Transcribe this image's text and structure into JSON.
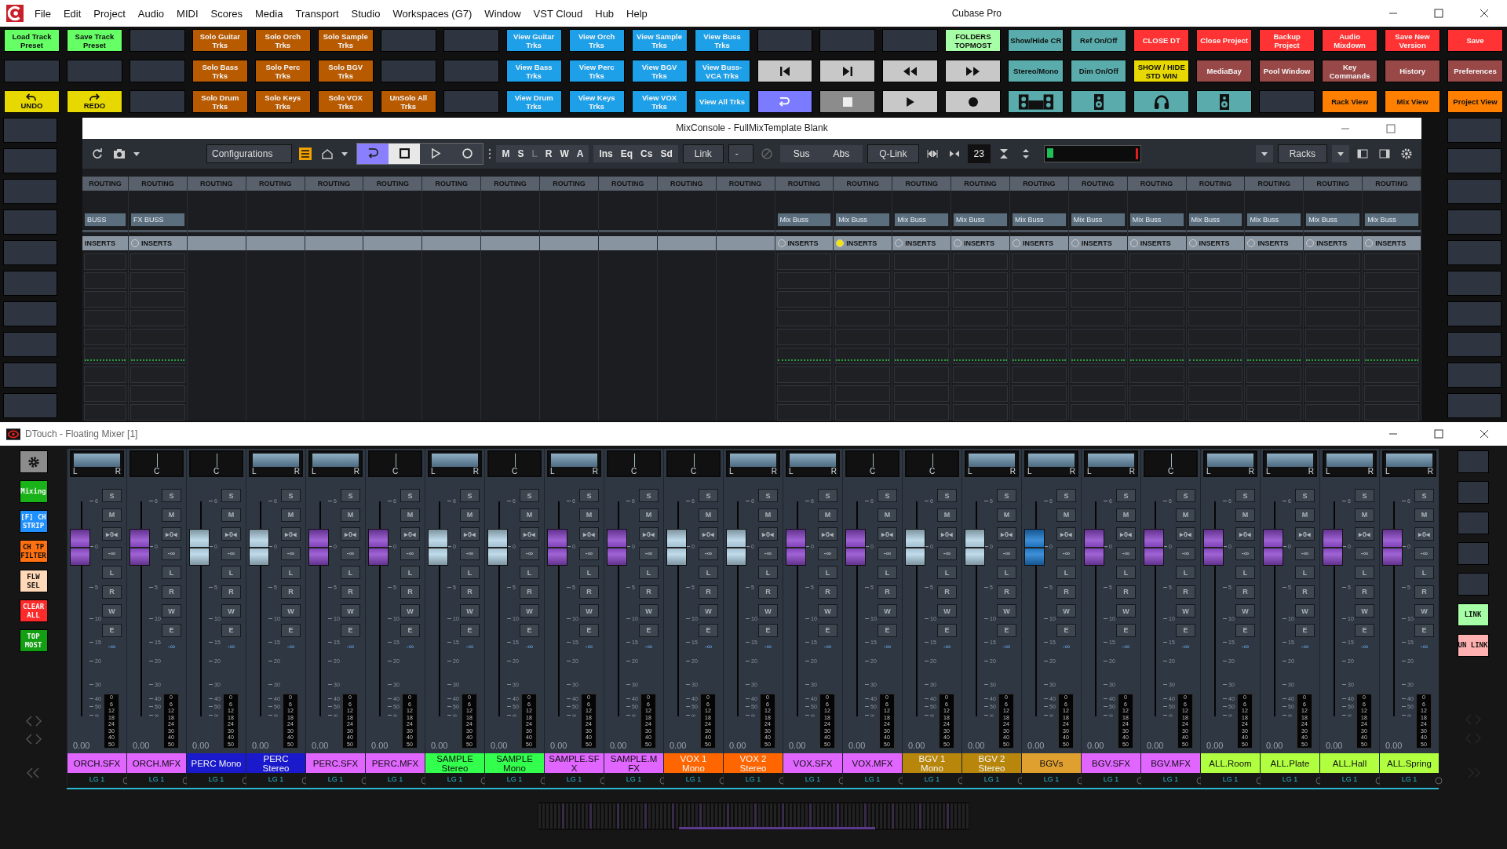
{
  "window": {
    "title": "Cubase Pro"
  },
  "menu": [
    "File",
    "Edit",
    "Project",
    "Audio",
    "MIDI",
    "Scores",
    "Media",
    "Transport",
    "Studio",
    "Workspaces (G7)",
    "Window",
    "VST Cloud",
    "Hub",
    "Help"
  ],
  "pad_rows": [
    [
      {
        "kind": "text",
        "label": "Load Track Preset",
        "color": "#66ff66"
      },
      {
        "kind": "text",
        "label": "Save Track Preset",
        "color": "#66ff66"
      },
      {
        "kind": "blank",
        "color": "#2e3540"
      },
      {
        "kind": "text",
        "label": "Solo Guitar Trks",
        "color": "#b85a00"
      },
      {
        "kind": "text",
        "label": "Solo Orch Trks",
        "color": "#b85a00"
      },
      {
        "kind": "text",
        "label": "Solo Sample Trks",
        "color": "#b85a00"
      },
      {
        "kind": "blank",
        "color": "#2e3540"
      },
      {
        "kind": "blank",
        "color": "#2e3540"
      },
      {
        "kind": "text",
        "label": "View Guitar Trks",
        "color": "#1ea0e8"
      },
      {
        "kind": "text",
        "label": "View Orch Trks",
        "color": "#1ea0e8"
      },
      {
        "kind": "text",
        "label": "View Sample Trks",
        "color": "#1ea0e8"
      },
      {
        "kind": "text",
        "label": "View Buss Trks",
        "color": "#1ea0e8"
      },
      {
        "kind": "blank",
        "color": "#2e3540"
      },
      {
        "kind": "blank",
        "color": "#2e3540"
      },
      {
        "kind": "blank",
        "color": "#2e3540"
      },
      {
        "kind": "text",
        "label": "FOLDERS TOPMOST",
        "color": "#a6ffa6"
      },
      {
        "kind": "text",
        "label": "Show/Hide CR",
        "color": "#5aacac"
      },
      {
        "kind": "text",
        "label": "Ref On/Off",
        "color": "#5aacac"
      },
      {
        "kind": "text",
        "label": "CLOSE DT",
        "color": "#ff3333"
      },
      {
        "kind": "text",
        "label": "Close Project",
        "color": "#ff3333"
      },
      {
        "kind": "text",
        "label": "Backup Project",
        "color": "#ff3333"
      },
      {
        "kind": "text",
        "label": "Audio Mixdown",
        "color": "#ff3333"
      },
      {
        "kind": "text",
        "label": "Save New Version",
        "color": "#ff3333"
      },
      {
        "kind": "text",
        "label": "Save",
        "color": "#ff3333"
      }
    ],
    [
      {
        "kind": "blank",
        "color": "#2e3540"
      },
      {
        "kind": "blank",
        "color": "#2e3540"
      },
      {
        "kind": "blank",
        "color": "#2e3540"
      },
      {
        "kind": "text",
        "label": "Solo Bass Trks",
        "color": "#b85a00"
      },
      {
        "kind": "text",
        "label": "Solo Perc Trks",
        "color": "#b85a00"
      },
      {
        "kind": "text",
        "label": "Solo BGV Trks",
        "color": "#b85a00"
      },
      {
        "kind": "blank",
        "color": "#2e3540"
      },
      {
        "kind": "blank",
        "color": "#2e3540"
      },
      {
        "kind": "text",
        "label": "View Bass Trks",
        "color": "#1ea0e8"
      },
      {
        "kind": "text",
        "label": "View Perc Trks",
        "color": "#1ea0e8"
      },
      {
        "kind": "text",
        "label": "View BGV Trks",
        "color": "#1ea0e8"
      },
      {
        "kind": "text",
        "label": "View Buss-VCA Trks",
        "color": "#1ea0e8"
      },
      {
        "kind": "prev",
        "color": "#c8c8c8"
      },
      {
        "kind": "next",
        "color": "#c8c8c8"
      },
      {
        "kind": "rewind",
        "color": "#c8c8c8"
      },
      {
        "kind": "forward",
        "color": "#c8c8c8"
      },
      {
        "kind": "text",
        "label": "Stereo/Mono",
        "color": "#5aacac"
      },
      {
        "kind": "text",
        "label": "Dim On/Off",
        "color": "#5aacac"
      },
      {
        "kind": "text",
        "label": "SHOW / HIDE STD WIN",
        "color": "#e6d800"
      },
      {
        "kind": "text",
        "label": "MediaBay",
        "color": "#994848"
      },
      {
        "kind": "text",
        "label": "Pool Window",
        "color": "#994848"
      },
      {
        "kind": "text",
        "label": "Key Commands",
        "color": "#994848"
      },
      {
        "kind": "text",
        "label": "History",
        "color": "#994848"
      },
      {
        "kind": "text",
        "label": "Preferences",
        "color": "#994848"
      }
    ],
    [
      {
        "kind": "undo",
        "label": "UNDO",
        "color": "#e6d800"
      },
      {
        "kind": "redo",
        "label": "REDO",
        "color": "#e6d800"
      },
      {
        "kind": "blank",
        "color": "#2e3540"
      },
      {
        "kind": "text",
        "label": "Solo Drum Trks",
        "color": "#b85a00"
      },
      {
        "kind": "text",
        "label": "Solo Keys Trks",
        "color": "#b85a00"
      },
      {
        "kind": "text",
        "label": "Solo VOX Trks",
        "color": "#b85a00"
      },
      {
        "kind": "text",
        "label": "UnSolo All Trks",
        "color": "#b85a00"
      },
      {
        "kind": "blank",
        "color": "#2e3540"
      },
      {
        "kind": "text",
        "label": "View Drum Trks",
        "color": "#1ea0e8"
      },
      {
        "kind": "text",
        "label": "View Keys Trks",
        "color": "#1ea0e8"
      },
      {
        "kind": "text",
        "label": "View VOX Trks",
        "color": "#1ea0e8"
      },
      {
        "kind": "text",
        "label": "View All Trks",
        "color": "#1ea0e8"
      },
      {
        "kind": "cycle",
        "color": "#7b7bff"
      },
      {
        "kind": "stop",
        "color": "#8c8c8c"
      },
      {
        "kind": "play",
        "color": "#c8c8c8"
      },
      {
        "kind": "record",
        "color": "#c8c8c8"
      },
      {
        "kind": "tape",
        "color": "#5aacac"
      },
      {
        "kind": "speaker",
        "color": "#5aacac"
      },
      {
        "kind": "headphones",
        "color": "#5aacac"
      },
      {
        "kind": "speaker",
        "color": "#5aacac"
      },
      {
        "kind": "blank",
        "color": "#2e3540"
      },
      {
        "kind": "text",
        "label": "Rack View",
        "color": "#ff8000"
      },
      {
        "kind": "text",
        "label": "Mix View",
        "color": "#ff8000"
      },
      {
        "kind": "text",
        "label": "Project View",
        "color": "#ff8000"
      }
    ]
  ],
  "side_left": [
    {
      "kind": "blank"
    },
    {
      "kind": "blank"
    },
    {
      "kind": "blank"
    },
    {
      "kind": "blank"
    },
    {
      "kind": "blank"
    },
    {
      "kind": "blank"
    },
    {
      "kind": "blank"
    },
    {
      "kind": "blank"
    },
    {
      "kind": "blank"
    },
    {
      "kind": "blank"
    }
  ],
  "side_right": [
    {
      "kind": "blank"
    },
    {
      "kind": "blank"
    },
    {
      "kind": "blank"
    },
    {
      "kind": "blank"
    },
    {
      "kind": "blank"
    },
    {
      "kind": "blank"
    },
    {
      "kind": "blank"
    },
    {
      "kind": "blank"
    },
    {
      "kind": "blank"
    },
    {
      "kind": "blank"
    }
  ],
  "mixconsole": {
    "title": "MixConsole - FullMixTemplate Blank",
    "toolbar": {
      "configurations": "Configurations",
      "automation": [
        {
          "label": "M",
          "enabled": true
        },
        {
          "label": "S",
          "enabled": true
        },
        {
          "label": "L",
          "enabled": false
        },
        {
          "label": "R",
          "enabled": true
        },
        {
          "label": "W",
          "enabled": true
        },
        {
          "label": "A",
          "enabled": true
        }
      ],
      "sections": [
        "Ins",
        "Eq",
        "Cs",
        "Sd"
      ],
      "link": "Link",
      "link_mode": "-",
      "sus": "Sus",
      "abs": "Abs",
      "qlink": "Q-Link",
      "count": "23",
      "racks": "Racks"
    },
    "columns": [
      {
        "routing": "ROUTING",
        "buss": "BUSS",
        "inserts": "INSERTS",
        "active": true
      },
      {
        "routing": "ROUTING",
        "buss": "FX BUSS",
        "inserts": "INSERTS",
        "led_lit": false,
        "active": true
      },
      {
        "routing": "ROUTING",
        "active": false
      },
      {
        "routing": "ROUTING",
        "active": false
      },
      {
        "routing": "ROUTING",
        "active": false
      },
      {
        "routing": "ROUTING",
        "active": false
      },
      {
        "routing": "ROUTING",
        "active": false
      },
      {
        "routing": "ROUTING",
        "active": false
      },
      {
        "routing": "ROUTING",
        "active": false
      },
      {
        "routing": "ROUTING",
        "active": false
      },
      {
        "routing": "ROUTING",
        "active": false
      },
      {
        "routing": "ROUTING",
        "active": false
      },
      {
        "routing": "ROUTING",
        "buss": "Mix Buss",
        "inserts": "INSERTS",
        "led_lit": false,
        "active": true
      },
      {
        "routing": "ROUTING",
        "buss": "Mix Buss",
        "inserts": "INSERTS",
        "led_lit": true,
        "active": true
      },
      {
        "routing": "ROUTING",
        "buss": "Mix Buss",
        "inserts": "INSERTS",
        "led_lit": false,
        "active": true
      },
      {
        "routing": "ROUTING",
        "buss": "Mix Buss",
        "inserts": "INSERTS",
        "led_lit": false,
        "active": true
      },
      {
        "routing": "ROUTING",
        "buss": "Mix Buss",
        "inserts": "INSERTS",
        "led_lit": false,
        "active": true
      },
      {
        "routing": "ROUTING",
        "buss": "Mix Buss",
        "inserts": "INSERTS",
        "led_lit": false,
        "active": true
      },
      {
        "routing": "ROUTING",
        "buss": "Mix Buss",
        "inserts": "INSERTS",
        "led_lit": false,
        "active": true
      },
      {
        "routing": "ROUTING",
        "buss": "Mix Buss",
        "inserts": "INSERTS",
        "led_lit": false,
        "active": true
      },
      {
        "routing": "ROUTING",
        "buss": "Mix Buss",
        "inserts": "INSERTS",
        "led_lit": false,
        "active": true
      },
      {
        "routing": "ROUTING",
        "buss": "Mix Buss",
        "inserts": "INSERTS",
        "led_lit": false,
        "active": true
      },
      {
        "routing": "ROUTING",
        "buss": "Mix Buss",
        "inserts": "INSERTS",
        "led_lit": false,
        "active": true
      }
    ]
  },
  "mixer": {
    "title": "DTouch - Floating Mixer [1]",
    "left_buttons": [
      {
        "kind": "gear",
        "color": "#8c8c8c"
      },
      {
        "kind": "text",
        "label": "Mixing",
        "color": "#19b319"
      },
      {
        "kind": "text",
        "label": "[F] CH STRIP",
        "color": "#1e90ff"
      },
      {
        "kind": "text",
        "label": "CH TP FILTER",
        "color": "#ff7010"
      },
      {
        "kind": "text",
        "label": "FLW SEL",
        "color": "#ffd8b8"
      },
      {
        "kind": "text",
        "label": "CLEAR ALL",
        "color": "#ff2a2a"
      },
      {
        "kind": "text",
        "label": "TOP MOST",
        "color": "#12a012"
      }
    ],
    "right_buttons": [
      {
        "kind": "blank",
        "color": "#2e3540"
      },
      {
        "kind": "blank",
        "color": "#2e3540"
      },
      {
        "kind": "blank",
        "color": "#2e3540"
      },
      {
        "kind": "blank",
        "color": "#2e3540"
      },
      {
        "kind": "blank",
        "color": "#2e3540"
      },
      {
        "kind": "text",
        "label": "LINK",
        "color": "#a6ffa6"
      },
      {
        "kind": "text",
        "label": "UN LINK",
        "color": "#ffb0b0"
      }
    ],
    "strips": [
      {
        "name": "ORCH.SFX",
        "color": "#e066ff",
        "pan": {
          "kind": "stereo",
          "labels": [
            "L",
            "R"
          ]
        },
        "fader": {
          "color": "#8e48cc"
        },
        "buttons": [
          "S",
          "M",
          "▸0◂",
          "-∞",
          "L",
          "R",
          "W",
          "E"
        ],
        "reading": "-∞",
        "fader_scale": [
          "6",
          "0",
          "5",
          "10",
          "15",
          "20",
          "30",
          "40",
          "50",
          "∞"
        ],
        "meter_scale": [
          "0",
          "6",
          "12",
          "18",
          "24",
          "30",
          "40",
          "50"
        ],
        "value": "0.00",
        "group": "LG 1"
      },
      {
        "name": "ORCH.MFX",
        "color": "#e066ff",
        "pan": {
          "kind": "mono",
          "labels": [
            "C"
          ]
        },
        "fader": {
          "color": "#8e48cc"
        },
        "buttons": [
          "S",
          "M",
          "▸0◂",
          "-∞",
          "L",
          "R",
          "W",
          "E"
        ],
        "reading": "-∞",
        "fader_scale": [
          "6",
          "0",
          "5",
          "10",
          "15",
          "20",
          "30",
          "40",
          "50",
          "∞"
        ],
        "meter_scale": [
          "0",
          "6",
          "12",
          "18",
          "24",
          "30",
          "40",
          "50"
        ],
        "value": "0.00",
        "group": "LG 1"
      },
      {
        "name": "PERC Mono",
        "color": "#1a1acc",
        "pan": {
          "kind": "mono",
          "labels": [
            "C"
          ]
        },
        "fader": {
          "color": "#b4d4e6"
        },
        "buttons": [
          "S",
          "M",
          "▸0◂",
          "-∞",
          "L",
          "R",
          "W",
          "E"
        ],
        "reading": "-∞",
        "fader_scale": [
          "6",
          "0",
          "5",
          "10",
          "15",
          "20",
          "30",
          "40",
          "50",
          "∞"
        ],
        "meter_scale": [
          "0",
          "6",
          "12",
          "18",
          "24",
          "30",
          "40",
          "50"
        ],
        "value": "0.00",
        "group": "LG 1"
      },
      {
        "name": "PERC Stereo",
        "color": "#1a1acc",
        "pan": {
          "kind": "stereo",
          "labels": [
            "L",
            "R"
          ]
        },
        "fader": {
          "color": "#b4d4e6"
        },
        "buttons": [
          "S",
          "M",
          "▸0◂",
          "-∞",
          "L",
          "R",
          "W",
          "E"
        ],
        "reading": "-∞",
        "fader_scale": [
          "6",
          "0",
          "5",
          "10",
          "15",
          "20",
          "30",
          "40",
          "50",
          "∞"
        ],
        "meter_scale": [
          "0",
          "6",
          "12",
          "18",
          "24",
          "30",
          "40",
          "50"
        ],
        "value": "0.00",
        "group": "LG 1"
      },
      {
        "name": "PERC.SFX",
        "color": "#e066ff",
        "pan": {
          "kind": "stereo",
          "labels": [
            "L",
            "R"
          ]
        },
        "fader": {
          "color": "#8e48cc"
        },
        "buttons": [
          "S",
          "M",
          "▸0◂",
          "-∞",
          "L",
          "R",
          "W",
          "E"
        ],
        "reading": "-∞",
        "fader_scale": [
          "6",
          "0",
          "5",
          "10",
          "15",
          "20",
          "30",
          "40",
          "50",
          "∞"
        ],
        "meter_scale": [
          "0",
          "6",
          "12",
          "18",
          "24",
          "30",
          "40",
          "50"
        ],
        "value": "0.00",
        "group": "LG 1"
      },
      {
        "name": "PERC.MFX",
        "color": "#e066ff",
        "pan": {
          "kind": "mono",
          "labels": [
            "C"
          ]
        },
        "fader": {
          "color": "#8e48cc"
        },
        "buttons": [
          "S",
          "M",
          "▸0◂",
          "-∞",
          "L",
          "R",
          "W",
          "E"
        ],
        "reading": "-∞",
        "fader_scale": [
          "6",
          "0",
          "5",
          "10",
          "15",
          "20",
          "30",
          "40",
          "50",
          "∞"
        ],
        "meter_scale": [
          "0",
          "6",
          "12",
          "18",
          "24",
          "30",
          "40",
          "50"
        ],
        "value": "0.00",
        "group": "LG 1"
      },
      {
        "name": "SAMPLE Stereo",
        "color": "#33ff4d",
        "pan": {
          "kind": "stereo",
          "labels": [
            "L",
            "R"
          ]
        },
        "fader": {
          "color": "#b4d4e6"
        },
        "buttons": [
          "S",
          "M",
          "▸0◂",
          "-∞",
          "L",
          "R",
          "W",
          "E"
        ],
        "reading": "-∞",
        "fader_scale": [
          "6",
          "0",
          "5",
          "10",
          "15",
          "20",
          "30",
          "40",
          "50",
          "∞"
        ],
        "meter_scale": [
          "0",
          "6",
          "12",
          "18",
          "24",
          "30",
          "40",
          "50"
        ],
        "value": "0.00",
        "group": "LG 1"
      },
      {
        "name": "SAMPLE Mono",
        "color": "#33ff4d",
        "pan": {
          "kind": "mono",
          "labels": [
            "C"
          ]
        },
        "fader": {
          "color": "#b4d4e6"
        },
        "buttons": [
          "S",
          "M",
          "▸0◂",
          "-∞",
          "L",
          "R",
          "W",
          "E"
        ],
        "reading": "-∞",
        "fader_scale": [
          "6",
          "0",
          "5",
          "10",
          "15",
          "20",
          "30",
          "40",
          "50",
          "∞"
        ],
        "meter_scale": [
          "0",
          "6",
          "12",
          "18",
          "24",
          "30",
          "40",
          "50"
        ],
        "value": "0.00",
        "group": "LG 1"
      },
      {
        "name": "SAMPLE.SFX",
        "color": "#e066ff",
        "pan": {
          "kind": "stereo",
          "labels": [
            "L",
            "R"
          ]
        },
        "fader": {
          "color": "#8e48cc"
        },
        "buttons": [
          "S",
          "M",
          "▸0◂",
          "-∞",
          "L",
          "R",
          "W",
          "E"
        ],
        "reading": "-∞",
        "fader_scale": [
          "6",
          "0",
          "5",
          "10",
          "15",
          "20",
          "30",
          "40",
          "50",
          "∞"
        ],
        "meter_scale": [
          "0",
          "6",
          "12",
          "18",
          "24",
          "30",
          "40",
          "50"
        ],
        "value": "0.00",
        "group": "LG 1"
      },
      {
        "name": "SAMPLE.MFX",
        "color": "#e066ff",
        "pan": {
          "kind": "mono",
          "labels": [
            "C"
          ]
        },
        "fader": {
          "color": "#8e48cc"
        },
        "buttons": [
          "S",
          "M",
          "▸0◂",
          "-∞",
          "L",
          "R",
          "W",
          "E"
        ],
        "reading": "-∞",
        "fader_scale": [
          "6",
          "0",
          "5",
          "10",
          "15",
          "20",
          "30",
          "40",
          "50",
          "∞"
        ],
        "meter_scale": [
          "0",
          "6",
          "12",
          "18",
          "24",
          "30",
          "40",
          "50"
        ],
        "value": "0.00",
        "group": "LG 1"
      },
      {
        "name": "VOX 1 Mono",
        "color": "#ff6600",
        "pan": {
          "kind": "mono",
          "labels": [
            "C"
          ]
        },
        "fader": {
          "color": "#b4d4e6"
        },
        "buttons": [
          "S",
          "M",
          "▸0◂",
          "-∞",
          "L",
          "R",
          "W",
          "E"
        ],
        "reading": "-∞",
        "fader_scale": [
          "6",
          "0",
          "5",
          "10",
          "15",
          "20",
          "30",
          "40",
          "50",
          "∞"
        ],
        "meter_scale": [
          "0",
          "6",
          "12",
          "18",
          "24",
          "30",
          "40",
          "50"
        ],
        "value": "0.00",
        "group": "LG 1"
      },
      {
        "name": "VOX 2 Stereo",
        "color": "#ff6600",
        "pan": {
          "kind": "stereo",
          "labels": [
            "L",
            "R"
          ]
        },
        "fader": {
          "color": "#b4d4e6"
        },
        "buttons": [
          "S",
          "M",
          "▸0◂",
          "-∞",
          "L",
          "R",
          "W",
          "E"
        ],
        "reading": "-∞",
        "fader_scale": [
          "6",
          "0",
          "5",
          "10",
          "15",
          "20",
          "30",
          "40",
          "50",
          "∞"
        ],
        "meter_scale": [
          "0",
          "6",
          "12",
          "18",
          "24",
          "30",
          "40",
          "50"
        ],
        "value": "0.00",
        "group": "LG 1"
      },
      {
        "name": "VOX.SFX",
        "color": "#e066ff",
        "pan": {
          "kind": "stereo",
          "labels": [
            "L",
            "R"
          ]
        },
        "fader": {
          "color": "#8e48cc"
        },
        "buttons": [
          "S",
          "M",
          "▸0◂",
          "-∞",
          "L",
          "R",
          "W",
          "E"
        ],
        "reading": "-∞",
        "fader_scale": [
          "6",
          "0",
          "5",
          "10",
          "15",
          "20",
          "30",
          "40",
          "50",
          "∞"
        ],
        "meter_scale": [
          "0",
          "6",
          "12",
          "18",
          "24",
          "30",
          "40",
          "50"
        ],
        "value": "0.00",
        "group": "LG 1"
      },
      {
        "name": "VOX.MFX",
        "color": "#e066ff",
        "pan": {
          "kind": "mono",
          "labels": [
            "C"
          ]
        },
        "fader": {
          "color": "#8e48cc"
        },
        "buttons": [
          "S",
          "M",
          "▸0◂",
          "-∞",
          "L",
          "R",
          "W",
          "E"
        ],
        "reading": "-∞",
        "fader_scale": [
          "6",
          "0",
          "5",
          "10",
          "15",
          "20",
          "30",
          "40",
          "50",
          "∞"
        ],
        "meter_scale": [
          "0",
          "6",
          "12",
          "18",
          "24",
          "30",
          "40",
          "50"
        ],
        "value": "0.00",
        "group": "LG 1"
      },
      {
        "name": "BGV 1 Mono",
        "color": "#b8860b",
        "pan": {
          "kind": "mono",
          "labels": [
            "C"
          ]
        },
        "fader": {
          "color": "#b4d4e6"
        },
        "buttons": [
          "S",
          "M",
          "▸0◂",
          "-∞",
          "L",
          "R",
          "W",
          "E"
        ],
        "reading": "-∞",
        "fader_scale": [
          "6",
          "0",
          "5",
          "10",
          "15",
          "20",
          "30",
          "40",
          "50",
          "∞"
        ],
        "meter_scale": [
          "0",
          "6",
          "12",
          "18",
          "24",
          "30",
          "40",
          "50"
        ],
        "value": "0.00",
        "group": "LG 1"
      },
      {
        "name": "BGV 2 Stereo",
        "color": "#b8860b",
        "pan": {
          "kind": "stereo",
          "labels": [
            "L",
            "R"
          ]
        },
        "fader": {
          "color": "#b4d4e6"
        },
        "buttons": [
          "S",
          "M",
          "▸0◂",
          "-∞",
          "L",
          "R",
          "W",
          "E"
        ],
        "reading": "-∞",
        "fader_scale": [
          "6",
          "0",
          "5",
          "10",
          "15",
          "20",
          "30",
          "40",
          "50",
          "∞"
        ],
        "meter_scale": [
          "0",
          "6",
          "12",
          "18",
          "24",
          "30",
          "40",
          "50"
        ],
        "value": "0.00",
        "group": "LG 1"
      },
      {
        "name": "BGVs",
        "color": "#e0a030",
        "pan": {
          "kind": "stereo",
          "labels": [
            "L",
            "R"
          ]
        },
        "fader": {
          "color": "#1e7cd0"
        },
        "buttons": [
          "S",
          "M",
          "▸0◂",
          "-∞",
          "L",
          "R",
          "W",
          "E"
        ],
        "reading": "-∞",
        "fader_scale": [
          "6",
          "0",
          "5",
          "10",
          "15",
          "20",
          "30",
          "40",
          "50",
          "∞"
        ],
        "meter_scale": [
          "0",
          "6",
          "12",
          "18",
          "24",
          "30",
          "40",
          "50"
        ],
        "value": "0.00",
        "group": "LG 1"
      },
      {
        "name": "BGV.SFX",
        "color": "#e066ff",
        "pan": {
          "kind": "stereo",
          "labels": [
            "L",
            "R"
          ]
        },
        "fader": {
          "color": "#8e48cc"
        },
        "buttons": [
          "S",
          "M",
          "▸0◂",
          "-∞",
          "L",
          "R",
          "W",
          "E"
        ],
        "reading": "-∞",
        "fader_scale": [
          "6",
          "0",
          "5",
          "10",
          "15",
          "20",
          "30",
          "40",
          "50",
          "∞"
        ],
        "meter_scale": [
          "0",
          "6",
          "12",
          "18",
          "24",
          "30",
          "40",
          "50"
        ],
        "value": "0.00",
        "group": "LG 1"
      },
      {
        "name": "BGV.MFX",
        "color": "#e066ff",
        "pan": {
          "kind": "mono",
          "labels": [
            "C"
          ]
        },
        "fader": {
          "color": "#8e48cc"
        },
        "buttons": [
          "S",
          "M",
          "▸0◂",
          "-∞",
          "L",
          "R",
          "W",
          "E"
        ],
        "reading": "-∞",
        "fader_scale": [
          "6",
          "0",
          "5",
          "10",
          "15",
          "20",
          "30",
          "40",
          "50",
          "∞"
        ],
        "meter_scale": [
          "0",
          "6",
          "12",
          "18",
          "24",
          "30",
          "40",
          "50"
        ],
        "value": "0.00",
        "group": "LG 1"
      },
      {
        "name": "ALL.Room",
        "color": "#b0ff40",
        "pan": {
          "kind": "stereo",
          "labels": [
            "L",
            "R"
          ]
        },
        "fader": {
          "color": "#8e48cc"
        },
        "buttons": [
          "S",
          "M",
          "▸0◂",
          "-∞",
          "L",
          "R",
          "W",
          "E"
        ],
        "reading": "-∞",
        "fader_scale": [
          "6",
          "0",
          "5",
          "10",
          "15",
          "20",
          "30",
          "40",
          "50",
          "∞"
        ],
        "meter_scale": [
          "0",
          "6",
          "12",
          "18",
          "24",
          "30",
          "40",
          "50"
        ],
        "value": "0.00",
        "group": "LG 1"
      },
      {
        "name": "ALL.Plate",
        "color": "#b0ff40",
        "pan": {
          "kind": "stereo",
          "labels": [
            "L",
            "R"
          ]
        },
        "fader": {
          "color": "#8e48cc"
        },
        "buttons": [
          "S",
          "M",
          "▸0◂",
          "-∞",
          "L",
          "R",
          "W",
          "E"
        ],
        "reading": "-∞",
        "fader_scale": [
          "6",
          "0",
          "5",
          "10",
          "15",
          "20",
          "30",
          "40",
          "50",
          "∞"
        ],
        "meter_scale": [
          "0",
          "6",
          "12",
          "18",
          "24",
          "30",
          "40",
          "50"
        ],
        "value": "0.00",
        "group": "LG 1"
      },
      {
        "name": "ALL.Hall",
        "color": "#b0ff40",
        "pan": {
          "kind": "stereo",
          "labels": [
            "L",
            "R"
          ]
        },
        "fader": {
          "color": "#8e48cc"
        },
        "buttons": [
          "S",
          "M",
          "▸0◂",
          "-∞",
          "L",
          "R",
          "W",
          "E"
        ],
        "reading": "-∞",
        "fader_scale": [
          "6",
          "0",
          "5",
          "10",
          "15",
          "20",
          "30",
          "40",
          "50",
          "∞"
        ],
        "meter_scale": [
          "0",
          "6",
          "12",
          "18",
          "24",
          "30",
          "40",
          "50"
        ],
        "value": "0.00",
        "group": "LG 1"
      },
      {
        "name": "ALL.Spring",
        "color": "#b0ff40",
        "pan": {
          "kind": "stereo",
          "labels": [
            "L",
            "R"
          ]
        },
        "fader": {
          "color": "#8e48cc"
        },
        "buttons": [
          "S",
          "M",
          "▸0◂",
          "-∞",
          "L",
          "R",
          "W",
          "E"
        ],
        "reading": "-∞",
        "fader_scale": [
          "6",
          "0",
          "5",
          "10",
          "15",
          "20",
          "30",
          "40",
          "50",
          "∞"
        ],
        "meter_scale": [
          "0",
          "6",
          "12",
          "18",
          "24",
          "30",
          "40",
          "50"
        ],
        "value": "0.00",
        "group": "LG 1"
      }
    ]
  }
}
